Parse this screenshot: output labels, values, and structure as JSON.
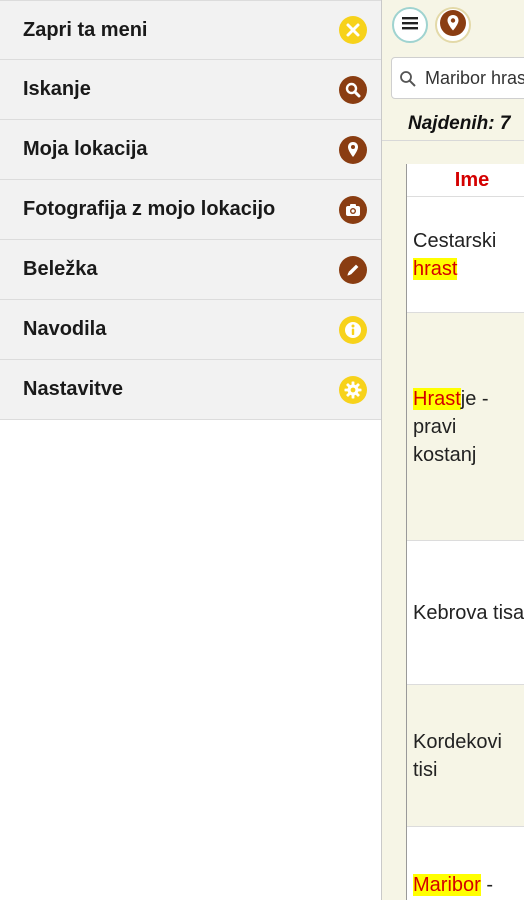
{
  "menu": {
    "items": [
      {
        "label": "Zapri ta meni",
        "icon": "close-icon",
        "color": "#f7d21b"
      },
      {
        "label": "Iskanje",
        "icon": "search-icon",
        "color": "#8a3d12"
      },
      {
        "label": "Moja lokacija",
        "icon": "location-pin-icon",
        "color": "#8a3d12"
      },
      {
        "label": "Fotografija z mojo lokacijo",
        "icon": "camera-icon",
        "color": "#8a3d12"
      },
      {
        "label": "Beležka",
        "icon": "pencil-icon",
        "color": "#8a3d12"
      },
      {
        "label": "Navodila",
        "icon": "info-icon",
        "color": "#f7d21b"
      },
      {
        "label": "Nastavitve",
        "icon": "gear-icon",
        "color": "#f7d21b"
      }
    ]
  },
  "search": {
    "value": "Maribor hrast",
    "placeholder": ""
  },
  "results": {
    "found_text": "Najdenih: 7",
    "column_header": "Ime",
    "rows": [
      {
        "before": "Cestarski ",
        "highlight": "hrast",
        "after": ""
      },
      {
        "before": "",
        "highlight": "Hrast",
        "after": "je - pravi kostanj"
      },
      {
        "before": "Kebrova tisa",
        "highlight": "",
        "after": ""
      },
      {
        "before": "Kordekovi tisi",
        "highlight": "",
        "after": ""
      },
      {
        "before": "",
        "highlight": "Maribor",
        "after": " -"
      }
    ]
  },
  "colors": {
    "accent_yellow": "#f7d21b",
    "accent_brown": "#8a3d12",
    "highlight": "#ffff00",
    "highlight_text": "#d40000"
  }
}
